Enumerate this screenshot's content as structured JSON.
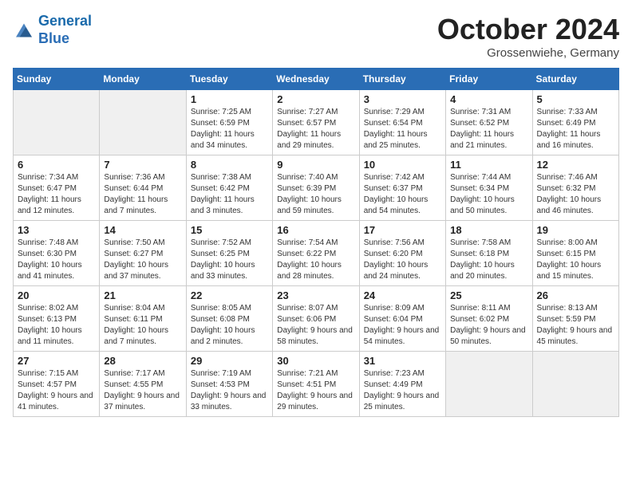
{
  "header": {
    "logo_line1": "General",
    "logo_line2": "Blue",
    "month_title": "October 2024",
    "location": "Grossenwiehe, Germany"
  },
  "days_of_week": [
    "Sunday",
    "Monday",
    "Tuesday",
    "Wednesday",
    "Thursday",
    "Friday",
    "Saturday"
  ],
  "weeks": [
    [
      {
        "day": "",
        "sunrise": "",
        "sunset": "",
        "daylight": ""
      },
      {
        "day": "",
        "sunrise": "",
        "sunset": "",
        "daylight": ""
      },
      {
        "day": "1",
        "sunrise": "Sunrise: 7:25 AM",
        "sunset": "Sunset: 6:59 PM",
        "daylight": "Daylight: 11 hours and 34 minutes."
      },
      {
        "day": "2",
        "sunrise": "Sunrise: 7:27 AM",
        "sunset": "Sunset: 6:57 PM",
        "daylight": "Daylight: 11 hours and 29 minutes."
      },
      {
        "day": "3",
        "sunrise": "Sunrise: 7:29 AM",
        "sunset": "Sunset: 6:54 PM",
        "daylight": "Daylight: 11 hours and 25 minutes."
      },
      {
        "day": "4",
        "sunrise": "Sunrise: 7:31 AM",
        "sunset": "Sunset: 6:52 PM",
        "daylight": "Daylight: 11 hours and 21 minutes."
      },
      {
        "day": "5",
        "sunrise": "Sunrise: 7:33 AM",
        "sunset": "Sunset: 6:49 PM",
        "daylight": "Daylight: 11 hours and 16 minutes."
      }
    ],
    [
      {
        "day": "6",
        "sunrise": "Sunrise: 7:34 AM",
        "sunset": "Sunset: 6:47 PM",
        "daylight": "Daylight: 11 hours and 12 minutes."
      },
      {
        "day": "7",
        "sunrise": "Sunrise: 7:36 AM",
        "sunset": "Sunset: 6:44 PM",
        "daylight": "Daylight: 11 hours and 7 minutes."
      },
      {
        "day": "8",
        "sunrise": "Sunrise: 7:38 AM",
        "sunset": "Sunset: 6:42 PM",
        "daylight": "Daylight: 11 hours and 3 minutes."
      },
      {
        "day": "9",
        "sunrise": "Sunrise: 7:40 AM",
        "sunset": "Sunset: 6:39 PM",
        "daylight": "Daylight: 10 hours and 59 minutes."
      },
      {
        "day": "10",
        "sunrise": "Sunrise: 7:42 AM",
        "sunset": "Sunset: 6:37 PM",
        "daylight": "Daylight: 10 hours and 54 minutes."
      },
      {
        "day": "11",
        "sunrise": "Sunrise: 7:44 AM",
        "sunset": "Sunset: 6:34 PM",
        "daylight": "Daylight: 10 hours and 50 minutes."
      },
      {
        "day": "12",
        "sunrise": "Sunrise: 7:46 AM",
        "sunset": "Sunset: 6:32 PM",
        "daylight": "Daylight: 10 hours and 46 minutes."
      }
    ],
    [
      {
        "day": "13",
        "sunrise": "Sunrise: 7:48 AM",
        "sunset": "Sunset: 6:30 PM",
        "daylight": "Daylight: 10 hours and 41 minutes."
      },
      {
        "day": "14",
        "sunrise": "Sunrise: 7:50 AM",
        "sunset": "Sunset: 6:27 PM",
        "daylight": "Daylight: 10 hours and 37 minutes."
      },
      {
        "day": "15",
        "sunrise": "Sunrise: 7:52 AM",
        "sunset": "Sunset: 6:25 PM",
        "daylight": "Daylight: 10 hours and 33 minutes."
      },
      {
        "day": "16",
        "sunrise": "Sunrise: 7:54 AM",
        "sunset": "Sunset: 6:22 PM",
        "daylight": "Daylight: 10 hours and 28 minutes."
      },
      {
        "day": "17",
        "sunrise": "Sunrise: 7:56 AM",
        "sunset": "Sunset: 6:20 PM",
        "daylight": "Daylight: 10 hours and 24 minutes."
      },
      {
        "day": "18",
        "sunrise": "Sunrise: 7:58 AM",
        "sunset": "Sunset: 6:18 PM",
        "daylight": "Daylight: 10 hours and 20 minutes."
      },
      {
        "day": "19",
        "sunrise": "Sunrise: 8:00 AM",
        "sunset": "Sunset: 6:15 PM",
        "daylight": "Daylight: 10 hours and 15 minutes."
      }
    ],
    [
      {
        "day": "20",
        "sunrise": "Sunrise: 8:02 AM",
        "sunset": "Sunset: 6:13 PM",
        "daylight": "Daylight: 10 hours and 11 minutes."
      },
      {
        "day": "21",
        "sunrise": "Sunrise: 8:04 AM",
        "sunset": "Sunset: 6:11 PM",
        "daylight": "Daylight: 10 hours and 7 minutes."
      },
      {
        "day": "22",
        "sunrise": "Sunrise: 8:05 AM",
        "sunset": "Sunset: 6:08 PM",
        "daylight": "Daylight: 10 hours and 2 minutes."
      },
      {
        "day": "23",
        "sunrise": "Sunrise: 8:07 AM",
        "sunset": "Sunset: 6:06 PM",
        "daylight": "Daylight: 9 hours and 58 minutes."
      },
      {
        "day": "24",
        "sunrise": "Sunrise: 8:09 AM",
        "sunset": "Sunset: 6:04 PM",
        "daylight": "Daylight: 9 hours and 54 minutes."
      },
      {
        "day": "25",
        "sunrise": "Sunrise: 8:11 AM",
        "sunset": "Sunset: 6:02 PM",
        "daylight": "Daylight: 9 hours and 50 minutes."
      },
      {
        "day": "26",
        "sunrise": "Sunrise: 8:13 AM",
        "sunset": "Sunset: 5:59 PM",
        "daylight": "Daylight: 9 hours and 45 minutes."
      }
    ],
    [
      {
        "day": "27",
        "sunrise": "Sunrise: 7:15 AM",
        "sunset": "Sunset: 4:57 PM",
        "daylight": "Daylight: 9 hours and 41 minutes."
      },
      {
        "day": "28",
        "sunrise": "Sunrise: 7:17 AM",
        "sunset": "Sunset: 4:55 PM",
        "daylight": "Daylight: 9 hours and 37 minutes."
      },
      {
        "day": "29",
        "sunrise": "Sunrise: 7:19 AM",
        "sunset": "Sunset: 4:53 PM",
        "daylight": "Daylight: 9 hours and 33 minutes."
      },
      {
        "day": "30",
        "sunrise": "Sunrise: 7:21 AM",
        "sunset": "Sunset: 4:51 PM",
        "daylight": "Daylight: 9 hours and 29 minutes."
      },
      {
        "day": "31",
        "sunrise": "Sunrise: 7:23 AM",
        "sunset": "Sunset: 4:49 PM",
        "daylight": "Daylight: 9 hours and 25 minutes."
      },
      {
        "day": "",
        "sunrise": "",
        "sunset": "",
        "daylight": ""
      },
      {
        "day": "",
        "sunrise": "",
        "sunset": "",
        "daylight": ""
      }
    ]
  ]
}
